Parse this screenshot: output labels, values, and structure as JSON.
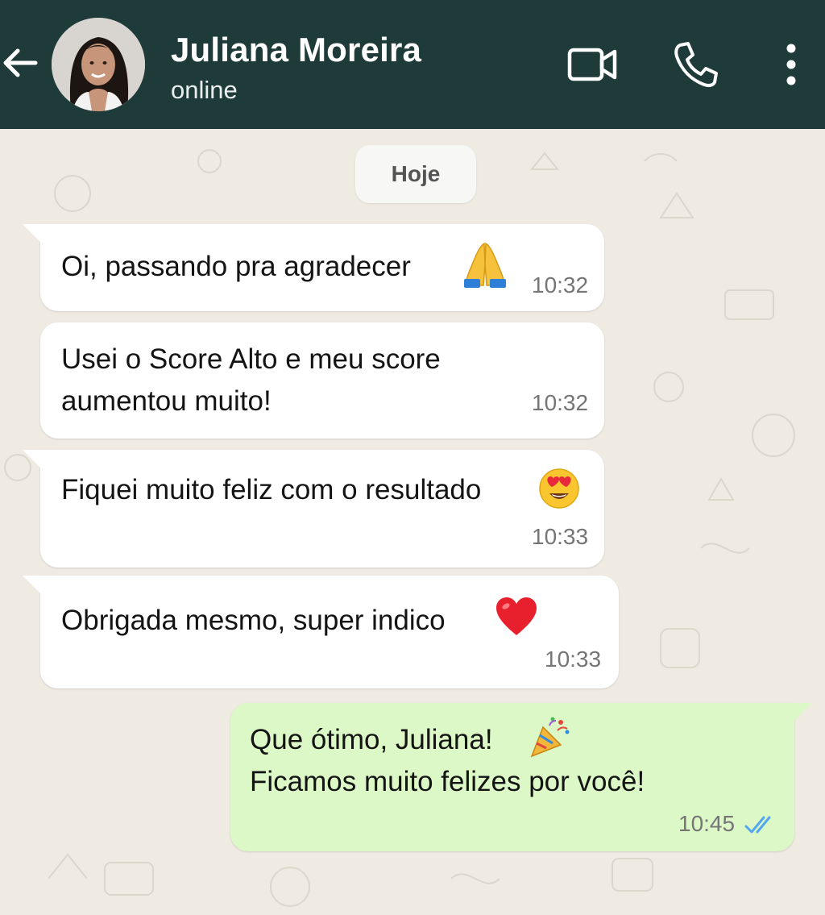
{
  "header": {
    "contact_name": "Juliana Moreira",
    "status": "online",
    "background_color": "#1e3b39",
    "icons": [
      "back-arrow-icon",
      "video-call-icon",
      "phone-icon",
      "more-options-icon"
    ]
  },
  "chat": {
    "date_chip": "Hoje",
    "wallpaper_color": "#efeae2",
    "messages": [
      {
        "direction": "incoming",
        "text": "Oi, passando pra agradecer",
        "emoji": "folded-hands",
        "time": "10:32"
      },
      {
        "direction": "incoming",
        "text": "Usei o Score Alto e meu score aumentou muito!",
        "time": "10:32"
      },
      {
        "direction": "incoming",
        "text": "Fiquei muito feliz com o resultado",
        "emoji": "heart-eyes",
        "time": "10:33"
      },
      {
        "direction": "incoming",
        "text": "Obrigada mesmo, super indico",
        "emoji": "red-heart",
        "time": "10:33"
      },
      {
        "direction": "outgoing",
        "line1": "Que ótimo, Juliana!",
        "line2": "Ficamos muito felizes por você!",
        "emoji": "party-popper",
        "time": "10:45",
        "read_ticks_color": "#53a6f0"
      }
    ]
  }
}
